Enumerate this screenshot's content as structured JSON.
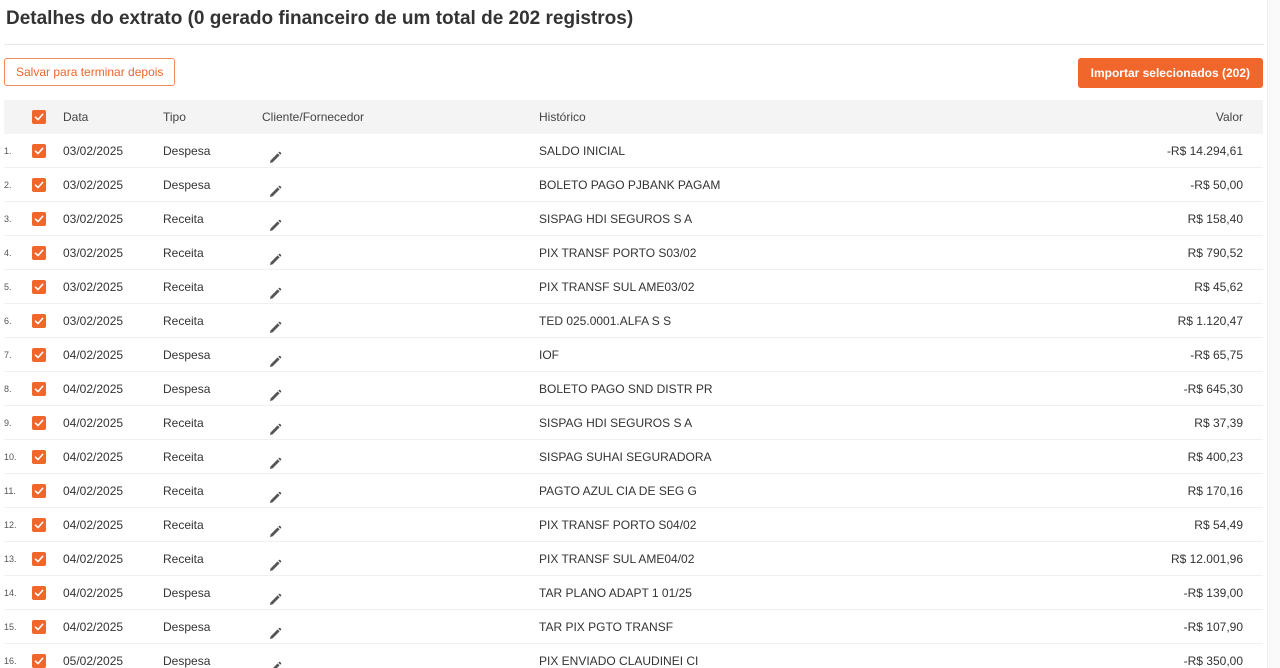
{
  "header": {
    "title": "Detalhes do extrato (0 gerado financeiro de um total de 202 registros)"
  },
  "toolbar": {
    "save_label": "Salvar para terminar depois",
    "import_label": "Importar selecionados (202)"
  },
  "colors": {
    "accent": "#f0662b",
    "header_bg": "#f4f4f4"
  },
  "table": {
    "columns": {
      "date": "Data",
      "type": "Tipo",
      "client": "Cliente/Fornecedor",
      "history": "Histórico",
      "value": "Valor"
    },
    "rows": [
      {
        "num": "1.",
        "date": "03/02/2025",
        "type": "Despesa",
        "history": "SALDO INICIAL",
        "value": "-R$ 14.294,61"
      },
      {
        "num": "2.",
        "date": "03/02/2025",
        "type": "Despesa",
        "history": "BOLETO PAGO PJBANK PAGAM",
        "value": "-R$ 50,00"
      },
      {
        "num": "3.",
        "date": "03/02/2025",
        "type": "Receita",
        "history": "SISPAG HDI SEGUROS S A",
        "value": "R$ 158,40"
      },
      {
        "num": "4.",
        "date": "03/02/2025",
        "type": "Receita",
        "history": "PIX TRANSF PORTO S03/02",
        "value": "R$ 790,52"
      },
      {
        "num": "5.",
        "date": "03/02/2025",
        "type": "Receita",
        "history": "PIX TRANSF SUL AME03/02",
        "value": "R$ 45,62"
      },
      {
        "num": "6.",
        "date": "03/02/2025",
        "type": "Receita",
        "history": "TED 025.0001.ALFA S S",
        "value": "R$ 1.120,47"
      },
      {
        "num": "7.",
        "date": "04/02/2025",
        "type": "Despesa",
        "history": "IOF",
        "value": "-R$ 65,75"
      },
      {
        "num": "8.",
        "date": "04/02/2025",
        "type": "Despesa",
        "history": "BOLETO PAGO SND DISTR PR",
        "value": "-R$ 645,30"
      },
      {
        "num": "9.",
        "date": "04/02/2025",
        "type": "Receita",
        "history": "SISPAG HDI SEGUROS S A",
        "value": "R$ 37,39"
      },
      {
        "num": "10.",
        "date": "04/02/2025",
        "type": "Receita",
        "history": "SISPAG SUHAI SEGURADORA",
        "value": "R$ 400,23"
      },
      {
        "num": "11.",
        "date": "04/02/2025",
        "type": "Receita",
        "history": "PAGTO AZUL CIA DE SEG G",
        "value": "R$ 170,16"
      },
      {
        "num": "12.",
        "date": "04/02/2025",
        "type": "Receita",
        "history": "PIX TRANSF PORTO S04/02",
        "value": "R$ 54,49"
      },
      {
        "num": "13.",
        "date": "04/02/2025",
        "type": "Receita",
        "history": "PIX TRANSF SUL AME04/02",
        "value": "R$ 12.001,96"
      },
      {
        "num": "14.",
        "date": "04/02/2025",
        "type": "Despesa",
        "history": "TAR PLANO ADAPT 1 01/25",
        "value": "-R$ 139,00"
      },
      {
        "num": "15.",
        "date": "04/02/2025",
        "type": "Despesa",
        "history": "TAR PIX PGTO TRANSF",
        "value": "-R$ 107,90"
      },
      {
        "num": "16.",
        "date": "05/02/2025",
        "type": "Despesa",
        "history": "PIX ENVIADO CLAUDINEI CI",
        "value": "-R$ 350,00"
      }
    ]
  }
}
